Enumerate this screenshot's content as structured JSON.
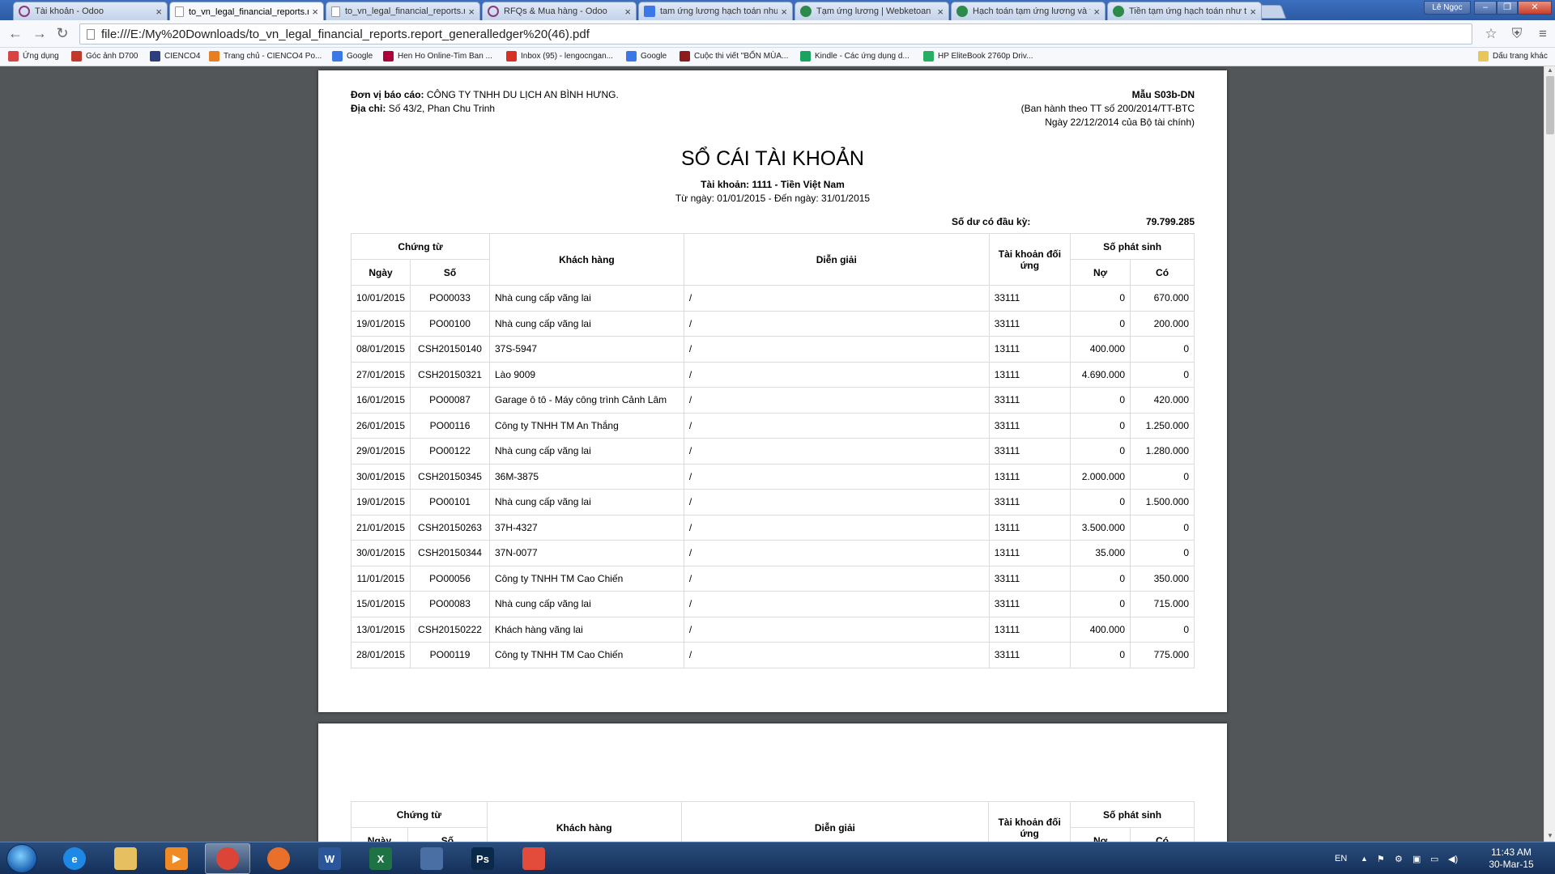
{
  "browser": {
    "tabs": [
      {
        "label": "Tài khoản - Odoo",
        "icon": "odoo"
      },
      {
        "label": "to_vn_legal_financial_reports.re",
        "icon": "doc"
      },
      {
        "label": "to_vn_legal_financial_reports.re",
        "icon": "doc"
      },
      {
        "label": "RFQs & Mua hàng - Odoo",
        "icon": "odoo"
      },
      {
        "label": "tam ứng lương hạch toán như t",
        "icon": "g"
      },
      {
        "label": "Tạm ứng lương | Webketoan -",
        "icon": "wt"
      },
      {
        "label": "Hạch toán tạm ứng lương và tr",
        "icon": "wt"
      },
      {
        "label": "Tiền tạm ứng hạch toán như th",
        "icon": "wt"
      }
    ],
    "profile": "Lê Ngọc",
    "url": "file:///E:/My%20Downloads/to_vn_legal_financial_reports.report_generalledger%20(46).pdf",
    "bookmarks": [
      {
        "label": "Ứng dụng",
        "color": "#d64541"
      },
      {
        "label": "Góc ảnh D700",
        "color": "#c0392b"
      },
      {
        "label": "CIENCO4",
        "color": "#2c3e80"
      },
      {
        "label": "Trang chủ - CIENCO4 Po...",
        "color": "#e67e22"
      },
      {
        "label": "Google",
        "color": "#3b78e7"
      },
      {
        "label": "Hen Ho Online-Tim Ban ...",
        "color": "#b0003a"
      },
      {
        "label": "Inbox (95) - lengocngan...",
        "color": "#d93025"
      },
      {
        "label": "Google",
        "color": "#3b78e7"
      },
      {
        "label": "Cuộc thi viết \"BỐN MÙA...",
        "color": "#8e1b1b"
      },
      {
        "label": "Kindle - Các ứng dụng d...",
        "color": "#1aa260"
      },
      {
        "label": "HP EliteBook 2760p Driv...",
        "color": "#27ae60"
      }
    ],
    "other_bookmarks": "Dấu trang khác"
  },
  "report": {
    "unit_label": "Đơn vị báo cáo:",
    "unit_value": "CÔNG TY TNHH DU LỊCH AN BÌNH HƯNG.",
    "address_label": "Địa chỉ:",
    "address_value": "Số 43/2, Phan Chu Trinh",
    "form_code": "Mẫu S03b-DN",
    "form_issued": "(Ban hành theo TT số 200/2014/TT-BTC",
    "form_date": "Ngày 22/12/2014 của Bộ tài chính)",
    "title": "SỔ CÁI TÀI KHOẢN",
    "account": "Tài khoản: 1111 - Tiền Việt Nam",
    "period": "Từ ngày: 01/01/2015 - Đến ngày: 31/01/2015",
    "opening_label": "Số dư có đầu kỳ:",
    "opening_value": "79.799.285",
    "headers": {
      "voucher": "Chứng từ",
      "date": "Ngày",
      "number": "Số",
      "customer": "Khách hàng",
      "description": "Diễn giải",
      "contra": "Tài khoản đối ứng",
      "amount": "Số phát sinh",
      "debit": "Nợ",
      "credit": "Có"
    },
    "rows": [
      {
        "date": "10/01/2015",
        "no": "PO00033",
        "customer": "Nhà cung cấp vãng lai",
        "desc": "/",
        "contra": "33111",
        "debit": "0",
        "credit": "670.000"
      },
      {
        "date": "19/01/2015",
        "no": "PO00100",
        "customer": "Nhà cung cấp vãng lai",
        "desc": "/",
        "contra": "33111",
        "debit": "0",
        "credit": "200.000"
      },
      {
        "date": "08/01/2015",
        "no": "CSH20150140",
        "customer": "37S-5947",
        "desc": "/",
        "contra": "13111",
        "debit": "400.000",
        "credit": "0"
      },
      {
        "date": "27/01/2015",
        "no": "CSH20150321",
        "customer": "Lào 9009",
        "desc": "/",
        "contra": "13111",
        "debit": "4.690.000",
        "credit": "0"
      },
      {
        "date": "16/01/2015",
        "no": "PO00087",
        "customer": "Garage ô tô - Máy công trình Cảnh Lâm",
        "desc": "/",
        "contra": "33111",
        "debit": "0",
        "credit": "420.000"
      },
      {
        "date": "26/01/2015",
        "no": "PO00116",
        "customer": "Công ty TNHH TM An Thắng",
        "desc": "/",
        "contra": "33111",
        "debit": "0",
        "credit": "1.250.000"
      },
      {
        "date": "29/01/2015",
        "no": "PO00122",
        "customer": "Nhà cung cấp vãng lai",
        "desc": "/",
        "contra": "33111",
        "debit": "0",
        "credit": "1.280.000"
      },
      {
        "date": "30/01/2015",
        "no": "CSH20150345",
        "customer": "36M-3875",
        "desc": "/",
        "contra": "13111",
        "debit": "2.000.000",
        "credit": "0"
      },
      {
        "date": "19/01/2015",
        "no": "PO00101",
        "customer": "Nhà cung cấp vãng lai",
        "desc": "/",
        "contra": "33111",
        "debit": "0",
        "credit": "1.500.000"
      },
      {
        "date": "21/01/2015",
        "no": "CSH20150263",
        "customer": "37H-4327",
        "desc": "/",
        "contra": "13111",
        "debit": "3.500.000",
        "credit": "0"
      },
      {
        "date": "30/01/2015",
        "no": "CSH20150344",
        "customer": "37N-0077",
        "desc": "/",
        "contra": "13111",
        "debit": "35.000",
        "credit": "0"
      },
      {
        "date": "11/01/2015",
        "no": "PO00056",
        "customer": "Công ty TNHH TM Cao Chiến",
        "desc": "/",
        "contra": "33111",
        "debit": "0",
        "credit": "350.000"
      },
      {
        "date": "15/01/2015",
        "no": "PO00083",
        "customer": "Nhà cung cấp vãng lai",
        "desc": "/",
        "contra": "33111",
        "debit": "0",
        "credit": "715.000"
      },
      {
        "date": "13/01/2015",
        "no": "CSH20150222",
        "customer": "Khách hàng vãng lai",
        "desc": "/",
        "contra": "13111",
        "debit": "400.000",
        "credit": "0"
      },
      {
        "date": "28/01/2015",
        "no": "PO00119",
        "customer": "Công ty TNHH TM Cao Chiến",
        "desc": "/",
        "contra": "33111",
        "debit": "0",
        "credit": "775.000"
      }
    ]
  },
  "taskbar": {
    "apps": [
      {
        "name": "ie",
        "label": "e",
        "color": "#1e88e5",
        "active": false
      },
      {
        "name": "explorer",
        "label": "",
        "color": "#e6c060",
        "active": false
      },
      {
        "name": "media-player",
        "label": "▶",
        "color": "#f08a24",
        "active": false
      },
      {
        "name": "chrome",
        "label": "",
        "color": "#db4437",
        "active": true
      },
      {
        "name": "firefox",
        "label": "",
        "color": "#e8702a",
        "active": false
      },
      {
        "name": "word",
        "label": "W",
        "color": "#2b579a",
        "active": false
      },
      {
        "name": "excel",
        "label": "X",
        "color": "#1f7244",
        "active": false
      },
      {
        "name": "app-window",
        "label": "",
        "color": "#4a6fa5",
        "active": false
      },
      {
        "name": "photoshop",
        "label": "Ps",
        "color": "#0b2a4a",
        "active": false
      },
      {
        "name": "apps-grid",
        "label": "",
        "color": "#e34b3a",
        "active": false
      }
    ],
    "language": "EN",
    "time": "11:43 AM",
    "date": "30-Mar-15"
  }
}
